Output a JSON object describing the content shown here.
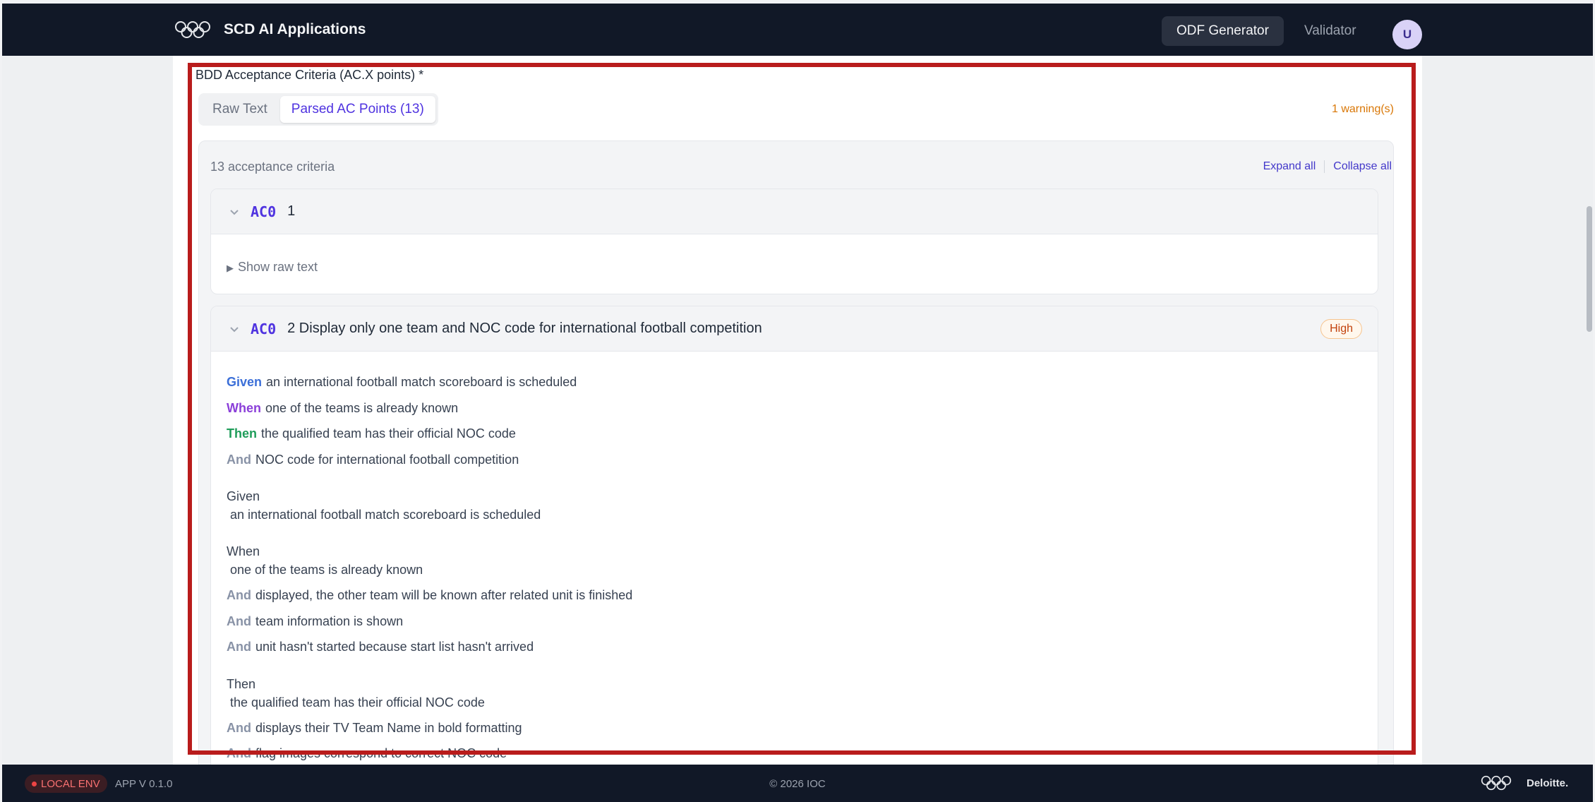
{
  "header": {
    "app_title": "SCD AI Applications",
    "logo_icon": "olympic-rings-icon",
    "nav": [
      {
        "label": "ODF Generator",
        "active": true
      },
      {
        "label": "Validator",
        "active": false
      }
    ],
    "avatar_initial": "U"
  },
  "field": {
    "label": "BDD Acceptance Criteria (AC.X points) *"
  },
  "tabs": [
    {
      "label": "Raw Text",
      "active": false
    },
    {
      "label": "Parsed AC Points (13)",
      "active": true
    }
  ],
  "warning_text": "1 warning(s)",
  "ac_list": {
    "count_text": "13 acceptance criteria",
    "expand_all": "Expand all",
    "collapse_all": "Collapse all"
  },
  "cards": [
    {
      "id": "AC0",
      "title": "1",
      "show_raw": "Show raw text"
    },
    {
      "id": "AC0",
      "title": "2 Display only one team and NOC code for international football competition",
      "priority": "High",
      "steps": [
        {
          "kw": "Given",
          "text": "an international football match scoreboard is scheduled"
        },
        {
          "kw": "When",
          "text": "one of the teams is already known"
        },
        {
          "kw": "Then",
          "text": "the qualified team has their official NOC code"
        },
        {
          "kw": "And",
          "text": "NOC code for international football competition"
        }
      ],
      "block_given": {
        "kw": "Given",
        "text": "an international football match scoreboard is scheduled"
      },
      "block_when": {
        "kw": "When",
        "text": "one of the teams is already known"
      },
      "when_ands": [
        {
          "kw": "And",
          "text": "displayed, the other team will be known after related unit is finished"
        },
        {
          "kw": "And",
          "text": "team information is shown"
        },
        {
          "kw": "And",
          "text": "unit hasn't started because start list hasn't arrived"
        }
      ],
      "block_then": {
        "kw": "Then",
        "text": "the qualified team has their official NOC code"
      },
      "then_ands": [
        {
          "kw": "And",
          "text": "displays their TV Team Name in bold formatting"
        },
        {
          "kw": "And",
          "text": "flag images correspond to correct NOC code"
        }
      ]
    }
  ],
  "footer": {
    "env_badge": "LOCAL ENV",
    "app_version": "APP V 0.1.0",
    "copyright": "© 2026 IOC",
    "brand": "Deloitte."
  },
  "colors": {
    "accent": "#4f33e0",
    "given": "#3b6fd8",
    "when": "#8b3fd9",
    "then": "#1f9d5a",
    "and": "#8892a6",
    "highlight_border": "#b91c1c",
    "warning": "#d97706"
  }
}
